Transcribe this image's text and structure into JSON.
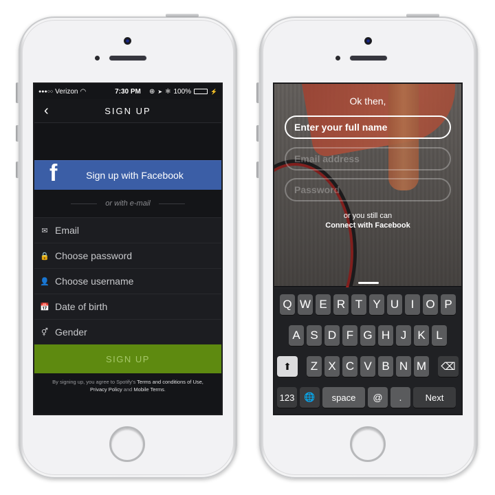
{
  "left_phone": {
    "status_bar": {
      "signal": "●●●○○",
      "carrier": "Verizon",
      "wifi_icon": "wifi-icon",
      "time": "7:30 PM",
      "orientation_lock_icon": "⊕",
      "location_icon": "➤",
      "bluetooth_icon": "✱",
      "battery_percent": "100%",
      "battery_level": 1.0,
      "battery_color": "#4cd964",
      "charging_icon": "⚡"
    },
    "nav": {
      "back_icon": "‹",
      "title": "SIGN UP"
    },
    "facebook_button": {
      "icon": "f",
      "label": "Sign up with Facebook",
      "color": "#3b5ea6"
    },
    "divider_text": "or with e-mail",
    "fields": [
      {
        "icon": "✉",
        "icon_name": "email-icon",
        "placeholder": "Email"
      },
      {
        "icon": "🔒",
        "icon_name": "lock-icon",
        "placeholder": "Choose password"
      },
      {
        "icon": "👤",
        "icon_name": "user-icon",
        "placeholder": "Choose username"
      },
      {
        "icon": "📅",
        "icon_name": "calendar-icon",
        "placeholder": "Date of birth"
      },
      {
        "icon": "⚥",
        "icon_name": "gender-icon",
        "placeholder": "Gender"
      }
    ],
    "signup_button": {
      "label": "SIGN UP",
      "color": "#5e8a10"
    },
    "terms": {
      "prefix": "By signing up, you agree to Spotify's ",
      "link1": "Terms and conditions of Use,",
      "link2": "Privacy Policy",
      "and": " and ",
      "link3": "Mobile Terms",
      "suffix": "."
    }
  },
  "right_phone": {
    "heading": "Ok then,",
    "inputs": [
      {
        "placeholder": "Enter your full name",
        "state": "active"
      },
      {
        "placeholder": "Email address",
        "state": "inactive"
      },
      {
        "placeholder": "Password",
        "state": "inactive"
      }
    ],
    "alt_text": "or you still can",
    "facebook_link": "Connect with Facebook",
    "keyboard": {
      "row1": [
        "Q",
        "W",
        "E",
        "R",
        "T",
        "Y",
        "U",
        "I",
        "O",
        "P"
      ],
      "row2": [
        "A",
        "S",
        "D",
        "F",
        "G",
        "H",
        "J",
        "K",
        "L"
      ],
      "row3": [
        "Z",
        "X",
        "C",
        "V",
        "B",
        "N",
        "M"
      ],
      "shift_icon": "⬆",
      "delete_icon": "⌫",
      "numbers_label": "123",
      "globe_icon": "🌐",
      "space_label": "space",
      "at_label": "@",
      "dot_label": ".",
      "next_label": "Next"
    }
  }
}
